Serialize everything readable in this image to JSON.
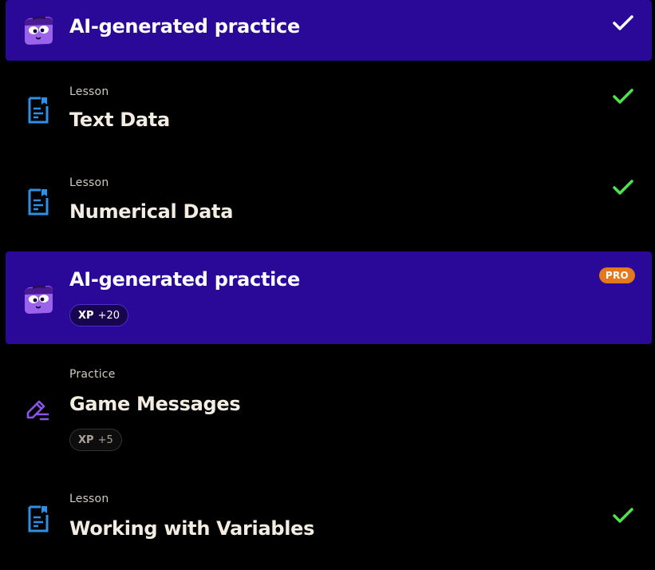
{
  "items": [
    {
      "type": "ai-practice",
      "title": "AI-generated practice",
      "icon": "robot-mascot-icon",
      "completed": true
    },
    {
      "type": "lesson",
      "kind_label": "Lesson",
      "title": "Text Data",
      "icon": "document-icon",
      "completed": true
    },
    {
      "type": "lesson",
      "kind_label": "Lesson",
      "title": "Numerical Data",
      "icon": "document-icon",
      "completed": true
    },
    {
      "type": "ai-practice",
      "title": "AI-generated practice",
      "icon": "robot-mascot-icon",
      "pro_label": "PRO",
      "xp_label": "XP",
      "xp_value": "+20",
      "completed": false
    },
    {
      "type": "practice",
      "kind_label": "Practice",
      "title": "Game Messages",
      "icon": "pencil-edit-icon",
      "xp_label": "XP",
      "xp_value": "+5",
      "completed": false
    },
    {
      "type": "lesson",
      "kind_label": "Lesson",
      "title": "Working with Variables",
      "icon": "document-icon",
      "completed": true
    }
  ],
  "colors": {
    "highlight_bg": "#2a0898",
    "check_green": "#4ee44e",
    "check_white": "#ffffff",
    "document_blue": "#2e8fe6",
    "pencil_purple": "#8a55e6",
    "pro_orange": "#e4781f"
  }
}
